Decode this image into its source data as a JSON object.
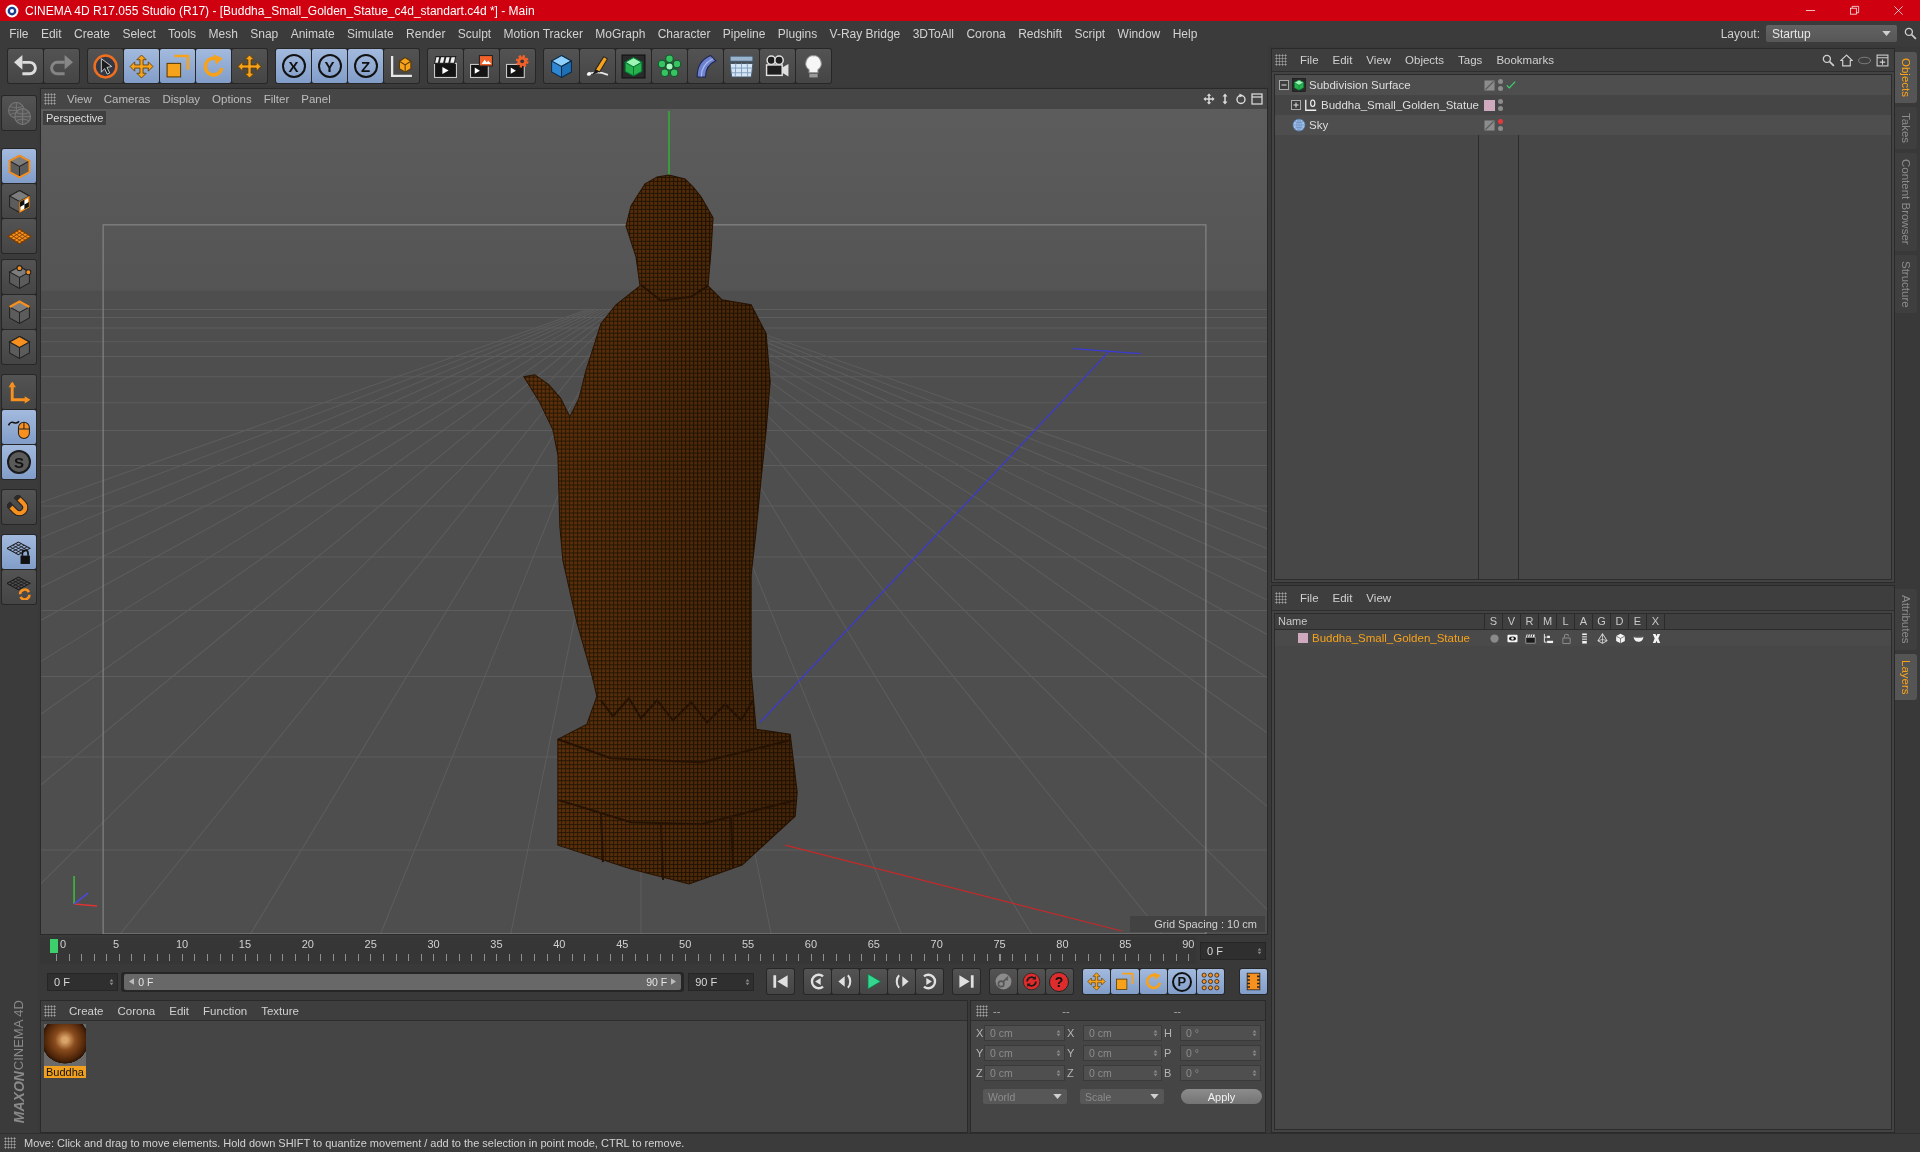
{
  "window": {
    "title": "CINEMA 4D R17.055 Studio (R17) - [Buddha_Small_Golden_Statue_c4d_standart.c4d *] - Main"
  },
  "menu_bar": [
    "File",
    "Edit",
    "Create",
    "Select",
    "Tools",
    "Mesh",
    "Snap",
    "Animate",
    "Simulate",
    "Render",
    "Sculpt",
    "Motion Tracker",
    "MoGraph",
    "Character",
    "Pipeline",
    "Plugins",
    "V-Ray Bridge",
    "3DToAll",
    "Corona",
    "Redshift",
    "Script",
    "Window",
    "Help"
  ],
  "layout": {
    "label": "Layout:",
    "value": "Startup"
  },
  "toolbar": {
    "groups": [
      [
        {
          "selected": false,
          "disabled": false
        },
        {
          "selected": false,
          "disabled": true
        }
      ],
      [
        {
          "selected": false,
          "disabled": false
        },
        {
          "selected": true,
          "disabled": false
        },
        {
          "selected": true,
          "disabled": false
        },
        {
          "selected": true,
          "disabled": false
        },
        {
          "selected": false,
          "disabled": false
        }
      ],
      [
        {
          "label": "X",
          "selected": true,
          "disabled": false
        },
        {
          "label": "Y",
          "selected": true,
          "disabled": false
        },
        {
          "label": "Z",
          "selected": true,
          "disabled": false
        },
        {
          "selected": false,
          "disabled": false
        }
      ],
      [
        {
          "selected": false,
          "disabled": false
        },
        {
          "selected": false,
          "disabled": false
        },
        {
          "selected": false,
          "disabled": false
        }
      ],
      [
        {
          "selected": false,
          "disabled": false
        },
        {
          "selected": false,
          "disabled": false
        },
        {
          "selected": false,
          "disabled": false
        },
        {
          "selected": false,
          "disabled": false
        },
        {
          "selected": false,
          "disabled": false
        },
        {
          "selected": false,
          "disabled": false
        },
        {
          "selected": false,
          "disabled": false
        },
        {
          "selected": false,
          "disabled": false
        }
      ]
    ]
  },
  "left_toolbar": {
    "groups": [
      [
        {
          "selected": false,
          "disabled": true
        }
      ],
      [
        {
          "selected": true,
          "disabled": false
        },
        {
          "selected": false,
          "disabled": false
        },
        {
          "selected": false,
          "disabled": false
        }
      ],
      [
        {
          "selected": false,
          "disabled": false
        },
        {
          "selected": false,
          "disabled": false
        },
        {
          "selected": false,
          "disabled": false
        }
      ],
      [
        {
          "selected": false,
          "disabled": false
        },
        {
          "selected": true,
          "disabled": false
        },
        {
          "label": "S",
          "selected": true,
          "disabled": false
        }
      ],
      [
        {
          "selected": false,
          "disabled": false
        }
      ],
      [
        {
          "selected": true,
          "disabled": false
        },
        {
          "selected": false,
          "disabled": false
        }
      ]
    ]
  },
  "viewport": {
    "menu": [
      "View",
      "Cameras",
      "Display",
      "Options",
      "Filter",
      "Panel"
    ],
    "camera": "Perspective",
    "grid_spacing": "Grid Spacing : 10 cm"
  },
  "timeline": {
    "frames": [
      "0",
      "5",
      "10",
      "15",
      "20",
      "25",
      "30",
      "35",
      "40",
      "45",
      "50",
      "55",
      "60",
      "65",
      "70",
      "75",
      "80",
      "85",
      "90"
    ],
    "playhead": {
      "level": 0
    },
    "current_frame": "0 F"
  },
  "transport": {
    "start_frame": "0 F",
    "range_slider": {
      "start": "0 F",
      "end": "90 F",
      "level": 1
    },
    "end_frame": "90 F",
    "groups": [
      [
        {
          "selected": false
        }
      ],
      [
        {
          "selected": false
        },
        {
          "selected": false
        },
        {
          "selected": false
        },
        {
          "selected": false
        },
        {
          "selected": false
        }
      ],
      [
        {
          "selected": false
        }
      ],
      [
        {
          "selected": false
        },
        {
          "selected": false
        },
        {
          "label": "?",
          "selected": false
        }
      ],
      [
        {
          "selected": true
        },
        {
          "selected": true
        },
        {
          "selected": true
        },
        {
          "label": "P",
          "selected": true
        },
        {
          "selected": true
        }
      ],
      [
        {
          "selected": true
        }
      ]
    ]
  },
  "material_manager": {
    "menu": [
      "Create",
      "Corona",
      "Edit",
      "Function",
      "Texture"
    ],
    "materials": [
      {
        "name": "Buddha",
        "selected": true
      }
    ]
  },
  "coordinates": {
    "headers": [
      "--",
      "--",
      "--"
    ],
    "disabled": true,
    "rows": [
      {
        "position_axis": "X",
        "position": "0 cm",
        "size_axis": "X",
        "size": "0 cm",
        "rotation_axis": "H",
        "rotation": "0 °"
      },
      {
        "position_axis": "Y",
        "position": "0 cm",
        "size_axis": "Y",
        "size": "0 cm",
        "rotation_axis": "P",
        "rotation": "0 °"
      },
      {
        "position_axis": "Z",
        "position": "0 cm",
        "size_axis": "Z",
        "size": "0 cm",
        "rotation_axis": "B",
        "rotation": "0 °"
      }
    ],
    "coordinate_system": "World",
    "size_mode": "Scale",
    "apply": "Apply"
  },
  "object_manager": {
    "menu": [
      "File",
      "Edit",
      "View",
      "Objects",
      "Tags",
      "Bookmarks"
    ],
    "objects": [
      {
        "name": "Subdivision Surface",
        "kind": "subdivision",
        "selected": false,
        "expanded": true,
        "visibility_dots": [
          {
            "color": "#8c8c8c"
          },
          {
            "color": "#8c8c8c"
          }
        ],
        "checked": true,
        "children": [
          {
            "name": "Buddha_Small_Golden_Statue",
            "kind": "null_object",
            "selected": false,
            "expanded": false,
            "color": "#cfa9bd",
            "visibility_dots": [
              {
                "color": "#8c8c8c"
              },
              {
                "color": "#8c8c8c"
              }
            ],
            "checked": false
          }
        ]
      },
      {
        "name": "Sky",
        "kind": "sky",
        "selected": false,
        "visibility_dots": [
          {
            "color": "#e5383b"
          },
          {
            "color": "#8c8c8c"
          }
        ],
        "checked": false
      }
    ]
  },
  "layer_manager": {
    "menu": [
      "File",
      "Edit",
      "View"
    ],
    "columns": [
      "Name",
      "S",
      "V",
      "R",
      "M",
      "L",
      "A",
      "G",
      "D",
      "E",
      "X"
    ],
    "layers": [
      {
        "name": "Buddha_Small_Golden_Statue",
        "color": "#cfa9bd",
        "selected": true,
        "switches": [
          {
            "on": false
          },
          {
            "on": true
          },
          {
            "on": true
          },
          {
            "on": true
          },
          {
            "on": false
          },
          {
            "on": true
          },
          {
            "on": true
          },
          {
            "on": true
          },
          {
            "on": true
          },
          {
            "on": true
          }
        ]
      }
    ]
  },
  "side_tabs": {
    "upper": [
      {
        "label": "Objects",
        "selected": true
      },
      {
        "label": "Takes",
        "selected": false
      },
      {
        "label": "Content Browser",
        "selected": false
      },
      {
        "label": "Structure",
        "selected": false
      }
    ],
    "lower": [
      {
        "label": "Attributes",
        "selected": false
      },
      {
        "label": "Layers",
        "selected": true
      }
    ]
  },
  "logo": {
    "brand": "MAXON",
    "product": "CINEMA 4D"
  },
  "status_bar": {
    "text": "Move: Click and drag to move elements. Hold down SHIFT to quantize movement / add to the selection in point mode, CTRL to remove."
  }
}
